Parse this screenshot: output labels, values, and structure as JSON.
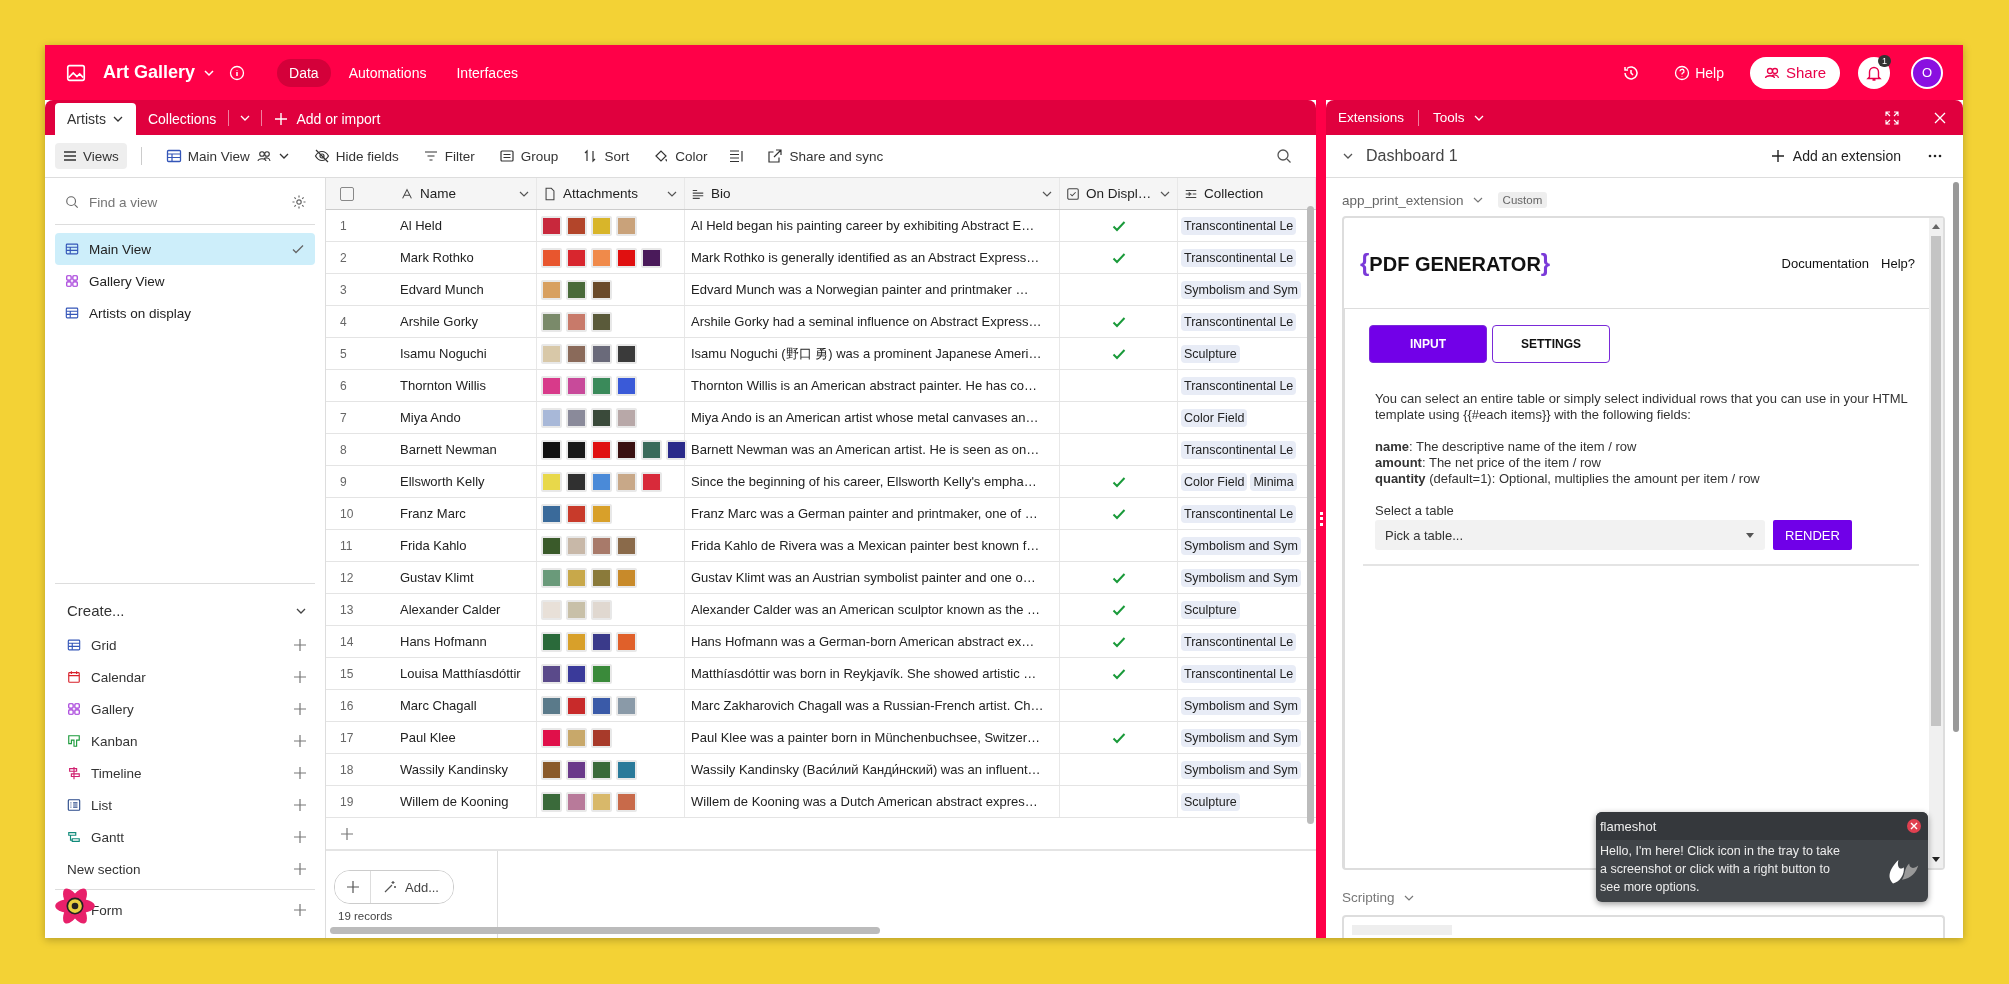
{
  "app": {
    "title": "Art Gallery",
    "nav": [
      {
        "label": "Data",
        "selected": true
      },
      {
        "label": "Automations",
        "selected": false
      },
      {
        "label": "Interfaces",
        "selected": false
      }
    ],
    "help": "Help",
    "share": "Share",
    "notifications": "1",
    "avatar": "O"
  },
  "tables": {
    "tabs": [
      {
        "label": "Artists",
        "selected": true
      },
      {
        "label": "Collections",
        "selected": false
      }
    ],
    "add": "Add or import"
  },
  "toolbar": {
    "views": "Views",
    "view_name": "Main View",
    "items": [
      {
        "kind": "hide",
        "label": "Hide fields"
      },
      {
        "kind": "filter",
        "label": "Filter"
      },
      {
        "kind": "group",
        "label": "Group"
      },
      {
        "kind": "sort",
        "label": "Sort"
      },
      {
        "kind": "color",
        "label": "Color"
      },
      {
        "kind": "row_height"
      },
      {
        "kind": "share",
        "label": "Share and sync"
      }
    ]
  },
  "sidebar": {
    "search_placeholder": "Find a view",
    "views": [
      {
        "kind": "grid",
        "label": "Main View",
        "selected": true
      },
      {
        "kind": "gallery",
        "label": "Gallery View",
        "selected": false
      },
      {
        "kind": "grid",
        "label": "Artists on display",
        "selected": false
      }
    ],
    "create_title": "Create...",
    "create_items": [
      {
        "kind": "grid",
        "label": "Grid"
      },
      {
        "kind": "calendar",
        "label": "Calendar"
      },
      {
        "kind": "gallery",
        "label": "Gallery"
      },
      {
        "kind": "kanban",
        "label": "Kanban"
      },
      {
        "kind": "timeline",
        "label": "Timeline"
      },
      {
        "kind": "list",
        "label": "List"
      },
      {
        "kind": "gantt",
        "label": "Gantt"
      },
      {
        "kind": "section",
        "label": "New section"
      },
      {
        "kind": "form",
        "label": "Form"
      }
    ]
  },
  "table": {
    "select_all": {
      "checked": false
    },
    "columns": [
      {
        "kind": "text",
        "label": "Name"
      },
      {
        "kind": "attachment",
        "label": "Attachments"
      },
      {
        "kind": "long_text",
        "label": "Bio"
      },
      {
        "kind": "checkbox",
        "label": "On Displ…"
      },
      {
        "kind": "link",
        "label": "Collection"
      }
    ],
    "rows": [
      {
        "number": "1",
        "name": "Al Held",
        "attachments": [
          {
            "color": "#c8283c"
          },
          {
            "color": "#b3452a"
          },
          {
            "color": "#d8b52a"
          },
          {
            "color": "#c9a27a"
          }
        ],
        "bio": "Al Held began his painting career by exhibiting Abstract E…",
        "on_display": true,
        "collections": [
          "Transcontinental Le"
        ]
      },
      {
        "number": "2",
        "name": "Mark Rothko",
        "attachments": [
          {
            "color": "#e8562e"
          },
          {
            "color": "#d8262e"
          },
          {
            "color": "#f08a4a"
          },
          {
            "color": "#e01010"
          },
          {
            "color": "#4a1a5a"
          }
        ],
        "bio": "Mark Rothko is generally identified as an Abstract Express…",
        "on_display": true,
        "collections": [
          "Transcontinental Le"
        ]
      },
      {
        "number": "3",
        "name": "Edvard Munch",
        "attachments": [
          {
            "color": "#d8a060"
          },
          {
            "color": "#4a6a3a"
          },
          {
            "color": "#6a4a2a"
          }
        ],
        "bio": "Edvard Munch was a Norwegian painter and printmaker …",
        "on_display": false,
        "collections": [
          "Symbolism and Sym"
        ]
      },
      {
        "number": "4",
        "name": "Arshile Gorky",
        "attachments": [
          {
            "color": "#7a8a6a"
          },
          {
            "color": "#c87a6a"
          },
          {
            "color": "#5a5a3a"
          }
        ],
        "bio": "Arshile Gorky had a seminal influence on Abstract Express…",
        "on_display": true,
        "collections": [
          "Transcontinental Le"
        ]
      },
      {
        "number": "5",
        "name": "Isamu Noguchi",
        "attachments": [
          {
            "color": "#d8c8a8"
          },
          {
            "color": "#8a6a5a"
          },
          {
            "color": "#6a6a7a"
          },
          {
            "color": "#3a3a3a"
          }
        ],
        "bio": "Isamu Noguchi (野口 勇) was a prominent Japanese Ameri…",
        "on_display": true,
        "collections": [
          "Sculpture"
        ]
      },
      {
        "number": "6",
        "name": "Thornton Willis",
        "attachments": [
          {
            "color": "#d83a8a"
          },
          {
            "color": "#c84a9a"
          },
          {
            "color": "#3a8a5a"
          },
          {
            "color": "#3a5ad8"
          }
        ],
        "bio": "Thornton Willis is an American abstract painter. He has co…",
        "on_display": false,
        "collections": [
          "Transcontinental Le"
        ]
      },
      {
        "number": "7",
        "name": "Miya Ando",
        "attachments": [
          {
            "color": "#a8b8d8"
          },
          {
            "color": "#8a8a9a"
          },
          {
            "color": "#3a4a3a"
          },
          {
            "color": "#b8a8a8"
          }
        ],
        "bio": "Miya Ando is an American artist whose metal canvases an…",
        "on_display": false,
        "collections": [
          "Color Field"
        ]
      },
      {
        "number": "8",
        "name": "Barnett Newman",
        "attachments": [
          {
            "color": "#101010"
          },
          {
            "color": "#181818"
          },
          {
            "color": "#e01010"
          },
          {
            "color": "#3a1010"
          },
          {
            "color": "#3a6a5a"
          },
          {
            "color": "#2a2a8a"
          }
        ],
        "bio": "Barnett Newman was an American artist. He is seen as on…",
        "on_display": false,
        "collections": [
          "Transcontinental Le"
        ]
      },
      {
        "number": "9",
        "name": "Ellsworth Kelly",
        "attachments": [
          {
            "color": "#e8d84a"
          },
          {
            "color": "#303030"
          },
          {
            "color": "#4a8ad8"
          },
          {
            "color": "#c8a888"
          },
          {
            "color": "#d82a3a"
          }
        ],
        "bio": "Since the beginning of his career, Ellsworth Kelly's empha…",
        "on_display": true,
        "collections": [
          "Color Field",
          "Minima"
        ]
      },
      {
        "number": "10",
        "name": "Franz Marc",
        "attachments": [
          {
            "color": "#3a6a9a"
          },
          {
            "color": "#c83a2a"
          },
          {
            "color": "#d8a02a"
          }
        ],
        "bio": "Franz Marc was a German painter and printmaker, one of …",
        "on_display": true,
        "collections": [
          "Transcontinental Le"
        ]
      },
      {
        "number": "11",
        "name": "Frida Kahlo",
        "attachments": [
          {
            "color": "#3a5a2a"
          },
          {
            "color": "#c8b8a8"
          },
          {
            "color": "#a87a6a"
          },
          {
            "color": "#8a6a4a"
          }
        ],
        "bio": "Frida Kahlo de Rivera was a Mexican painter best known f…",
        "on_display": false,
        "collections": [
          "Symbolism and Sym"
        ]
      },
      {
        "number": "12",
        "name": "Gustav Klimt",
        "attachments": [
          {
            "color": "#6a9a7a"
          },
          {
            "color": "#c8a84a"
          },
          {
            "color": "#8a7a3a"
          },
          {
            "color": "#c88a2a"
          }
        ],
        "bio": "Gustav Klimt was an Austrian symbolist painter and one o…",
        "on_display": true,
        "collections": [
          "Symbolism and Sym"
        ]
      },
      {
        "number": "13",
        "name": "Alexander Calder",
        "attachments": [
          {
            "color": "#e8e0d8"
          },
          {
            "color": "#c8c0a8"
          },
          {
            "color": "#e0d8d0"
          }
        ],
        "bio": "Alexander Calder was an American sculptor known as the …",
        "on_display": true,
        "collections": [
          "Sculpture"
        ]
      },
      {
        "number": "14",
        "name": "Hans Hofmann",
        "attachments": [
          {
            "color": "#2a6a3a"
          },
          {
            "color": "#d8a02a"
          },
          {
            "color": "#3a3a8a"
          },
          {
            "color": "#e0602a"
          }
        ],
        "bio": "Hans Hofmann was a German-born American abstract ex…",
        "on_display": true,
        "collections": [
          "Transcontinental Le"
        ]
      },
      {
        "number": "15",
        "name": "Louisa Matthíasdóttir",
        "attachments": [
          {
            "color": "#5a4a8a"
          },
          {
            "color": "#3a3a9a"
          },
          {
            "color": "#3a8a3a"
          }
        ],
        "bio": "Matthíasdóttir was born in Reykjavík. She showed artistic …",
        "on_display": true,
        "collections": [
          "Transcontinental Le"
        ]
      },
      {
        "number": "16",
        "name": "Marc Chagall",
        "attachments": [
          {
            "color": "#5a7a8a"
          },
          {
            "color": "#c82a2a"
          },
          {
            "color": "#3a5aa8"
          },
          {
            "color": "#8a9aa8"
          }
        ],
        "bio": "Marc Zakharovich Chagall was a Russian-French artist. Ch…",
        "on_display": false,
        "collections": [
          "Symbolism and Sym"
        ]
      },
      {
        "number": "17",
        "name": "Paul Klee",
        "attachments": [
          {
            "color": "#e0104a"
          },
          {
            "color": "#c8a86a"
          },
          {
            "color": "#a83a2a"
          }
        ],
        "bio": "Paul Klee was a painter born in Münchenbuchsee, Switzer…",
        "on_display": true,
        "collections": [
          "Symbolism and Sym"
        ]
      },
      {
        "number": "18",
        "name": "Wassily Kandinsky",
        "attachments": [
          {
            "color": "#8a5a2a"
          },
          {
            "color": "#6a3a8a"
          },
          {
            "color": "#3a6a3a"
          },
          {
            "color": "#2a7a9a"
          }
        ],
        "bio": "Wassily Kandinsky (Васи́лий Канди́нский) was an influent…",
        "on_display": false,
        "collections": [
          "Symbolism and Sym"
        ]
      },
      {
        "number": "19",
        "name": "Willem de Kooning",
        "attachments": [
          {
            "color": "#3a6a3a"
          },
          {
            "color": "#b87a9a"
          },
          {
            "color": "#d8b86a"
          },
          {
            "color": "#c86a4a"
          }
        ],
        "bio": "Willem de Kooning was a Dutch American abstract expres…",
        "on_display": false,
        "collections": [
          "Sculpture"
        ]
      }
    ],
    "add_label": "Add...",
    "records": "19 records"
  },
  "extensions": {
    "tabs": [
      "Extensions",
      "Tools"
    ],
    "dashboard": "Dashboard 1",
    "add_extension": "Add an extension",
    "extension_name": "app_print_extension",
    "badge": "Custom",
    "app": {
      "logo": {
        "open": "{",
        "text": "PDF GENERATOR",
        "close": "}"
      },
      "links": [
        "Documentation",
        "Help?"
      ],
      "tabs": [
        {
          "label": "INPUT",
          "selected": true
        },
        {
          "label": "SETTINGS",
          "selected": false
        }
      ],
      "intro": "You can select an entire table or simply select individual rows that you can use in your HTML template using {{#each items}} with the following fields:",
      "fields": [
        "**name**: The descriptive name of the item / row",
        "**amount**: The net price of the item / row",
        "**quantity** (default=1): Optional, multiplies the amount per item / row"
      ],
      "select_label": "Select a table",
      "select_placeholder": "Pick a table...",
      "render": "RENDER"
    },
    "scripting": "Scripting"
  },
  "notification": {
    "title": "flameshot",
    "message": "Hello, I'm here! Click icon in the tray to take a screenshot or click with a right button to see more options."
  }
}
